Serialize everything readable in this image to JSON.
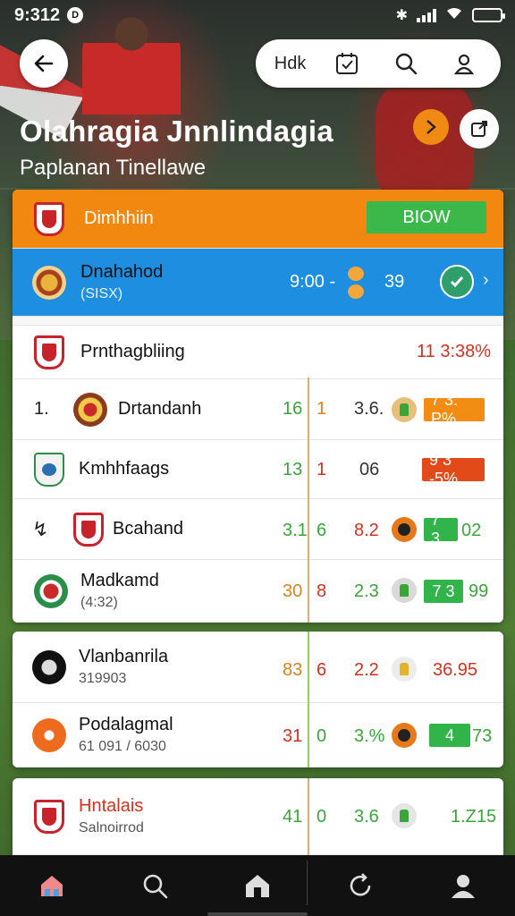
{
  "status": {
    "time": "9:312",
    "notif_badge": "D"
  },
  "header": {
    "pill_label": "Hdk",
    "title": "Olahragia Jnnlindagia",
    "subtitle": "Paplanan Tinellawe"
  },
  "card1": {
    "featured": {
      "name": "Dimhhiin",
      "button": "BIOW"
    },
    "selected": {
      "name": "Dnahahod",
      "sub": "(SISX)",
      "score_left": "9:00 -",
      "score_right": "39"
    },
    "rows": [
      {
        "name": "Prnthagbliing",
        "value": "11 3:38%"
      },
      {
        "rank": "1.",
        "name": "Drtandanh",
        "c1": "16",
        "c2": "1",
        "c3": "3.6.",
        "tag": "7 3. P%"
      },
      {
        "name": "Kmhhfaags",
        "c1": "13",
        "c2": "1",
        "c3": "06",
        "tag": "9 3 -5%"
      },
      {
        "name": "Bcahand",
        "c1": "3.1",
        "c2": "6",
        "c3": "8.2",
        "tag": "7 3",
        "val": "02"
      },
      {
        "name": "Madkamd",
        "sub": "(4:32)",
        "c1": "30",
        "c2": "8",
        "c3": "2.3",
        "tag": "7 3",
        "val": "99"
      }
    ]
  },
  "card2": {
    "rows": [
      {
        "name": "Vlanbanrila",
        "sub": "319903",
        "c1": "83",
        "c2": "6",
        "c3": "2.2",
        "val": "36.95"
      },
      {
        "name": "Podalagmal",
        "sub": "61 091 / 6030",
        "c1": "31",
        "c2": "0",
        "c3": "3.%",
        "tag": "4",
        "val": "73"
      }
    ]
  },
  "card3": {
    "rows": [
      {
        "name": "Hntalais",
        "sub": "Salnoirrod",
        "c1": "41",
        "c2": "0",
        "c3": "3.6",
        "val": "1.Z15"
      }
    ]
  },
  "colors": {
    "orange": "#f2880f",
    "blue": "#1d8ee0",
    "green": "#3aa63a",
    "red": "#d7301e"
  },
  "nav": [
    "home-icon",
    "search-icon",
    "stadium-icon",
    "refresh-icon",
    "profile-icon"
  ]
}
